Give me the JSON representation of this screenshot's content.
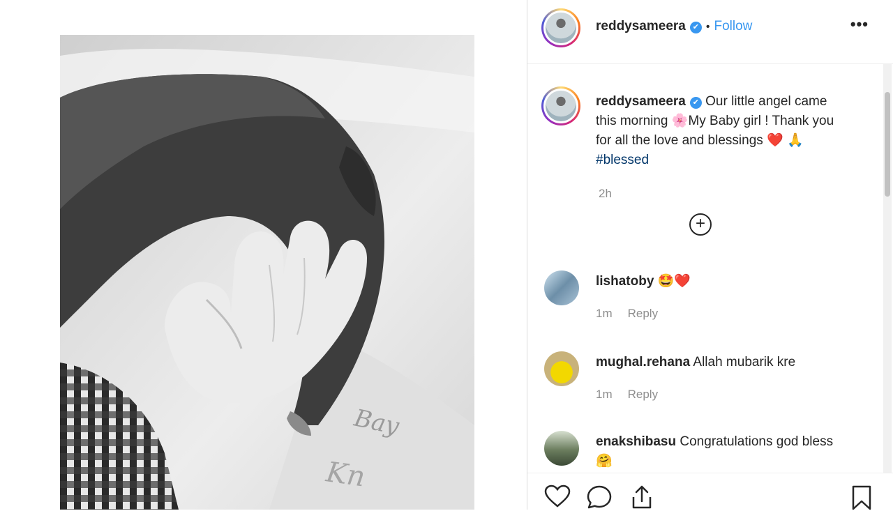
{
  "post": {
    "author": "reddysameera",
    "follow_label": "Follow",
    "separator": "•",
    "more_label": "•••",
    "verified_mark": "✔",
    "caption": {
      "text_1": "Our little angel came this morning ",
      "emoji_flower": "🌸",
      "text_2": "My Baby girl ! Thank you for all the love and blessings ",
      "emoji_heart": "❤️",
      "emoji_pray": "🙏",
      "hashtag": "#blessed"
    },
    "time": "2h",
    "load_more_icon": "plus-circle-icon"
  },
  "comments": [
    {
      "user": "lishatoby",
      "text": "",
      "emoji": "🤩❤️",
      "time": "1m",
      "reply_label": "Reply"
    },
    {
      "user": "mughal.rehana",
      "text": "Allah mubarik kre",
      "emoji": "",
      "time": "1m",
      "reply_label": "Reply"
    },
    {
      "user": "enakshibasu",
      "text": "Congratulations god bless",
      "emoji": "🤗",
      "time": "",
      "reply_label": ""
    }
  ],
  "icons": {
    "like": "heart-icon",
    "comment": "comment-icon",
    "share": "share-icon",
    "save": "bookmark-icon"
  },
  "colors": {
    "link_blue": "#3897f0",
    "text": "#262626",
    "muted": "#8e8e8e",
    "border": "#dbdbdb"
  }
}
